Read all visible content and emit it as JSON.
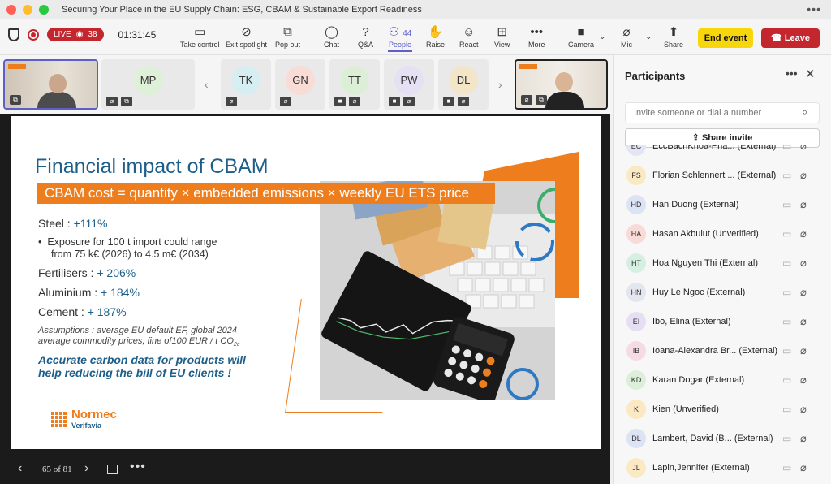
{
  "window": {
    "title": "Securing Your Place in the EU Supply Chain: ESG, CBAM & Sustainable Export Readiness"
  },
  "toolbar": {
    "live_label": "LIVE",
    "viewer_count": "38",
    "timer": "01:31:45",
    "people_count": "44",
    "buttons": [
      {
        "label": "Take control",
        "icon": "take-control-icon"
      },
      {
        "label": "Exit spotlight",
        "icon": "spotlight-off-icon"
      },
      {
        "label": "Pop out",
        "icon": "pop-out-icon"
      },
      {
        "label": "Chat",
        "icon": "chat-icon"
      },
      {
        "label": "Q&A",
        "icon": "qna-icon"
      },
      {
        "label": "People",
        "icon": "people-icon"
      },
      {
        "label": "Raise",
        "icon": "raise-hand-icon"
      },
      {
        "label": "React",
        "icon": "react-icon"
      },
      {
        "label": "View",
        "icon": "view-icon"
      },
      {
        "label": "More",
        "icon": "more-icon"
      },
      {
        "label": "Camera",
        "icon": "camera-icon"
      },
      {
        "label": "Mic",
        "icon": "mic-off-icon"
      },
      {
        "label": "Share",
        "icon": "share-icon"
      }
    ],
    "end_event": "End event",
    "leave": "Leave"
  },
  "gallery": {
    "tiles": [
      {
        "initials": "MP",
        "color": "#dff0d8"
      },
      {
        "initials": "TK",
        "color": "#d6eef2"
      },
      {
        "initials": "GN",
        "color": "#f8dcd5"
      },
      {
        "initials": "TT",
        "color": "#dcefd6"
      },
      {
        "initials": "PW",
        "color": "#e6e0f4"
      },
      {
        "initials": "DL",
        "color": "#f3e6c8"
      }
    ]
  },
  "slide": {
    "title": "Financial impact of CBAM",
    "formula": "CBAM cost = quantity × embedded emissions × weekly EU ETS price",
    "steel_label": "Steel : ",
    "steel_value": "+111%",
    "bullet_line1": "Exposure for 100 t import could range",
    "bullet_line2": "from 75 k€ (2026) to 4.5 m€ (2034)",
    "fert_label": "Fertilisers : ",
    "fert_value": "+ 206%",
    "alu_label": "Aluminium : ",
    "alu_value": "+ 184%",
    "cement_label": "Cement : ",
    "cement_value": "+ 187%",
    "assumption_line1": "Assumptions : average EU default EF, global 2024",
    "assumption_line2": "average commodity prices, fine of100 EUR / t CO",
    "assumption_sub": "2e",
    "accurate_line1": "Accurate carbon data for products will",
    "accurate_line2": "help reducing the bill of EU clients !",
    "logo_name": "Normec",
    "logo_sub": "Verifavia",
    "colors": {
      "accent": "#ee7d1d",
      "title": "#1e5f8a"
    }
  },
  "stage": {
    "page_indicator": "65 of 81"
  },
  "participants": {
    "title": "Participants",
    "invite_placeholder": "Invite someone or dial a number",
    "share_invite": "Share invite",
    "list": [
      {
        "initials": "EC",
        "name": "EccBachKhoa-Pha... (External)",
        "color": "#e3e5f3"
      },
      {
        "initials": "FS",
        "name": "Florian Schlennert ... (External)",
        "color": "#fbe9c4"
      },
      {
        "initials": "HD",
        "name": "Han Duong (External)",
        "color": "#dbe3f5"
      },
      {
        "initials": "HA",
        "name": "Hasan Akbulut (Unverified)",
        "color": "#f8dad6"
      },
      {
        "initials": "HT",
        "name": "Hoa Nguyen Thi (External)",
        "color": "#d6efe3"
      },
      {
        "initials": "HN",
        "name": "Huy Le Ngoc (External)",
        "color": "#e3e5ef"
      },
      {
        "initials": "EI",
        "name": "Ibo, Elina (External)",
        "color": "#e6dff4"
      },
      {
        "initials": "IB",
        "name": "Ioana-Alexandra Br... (External)",
        "color": "#f6dbe3"
      },
      {
        "initials": "KD",
        "name": "Karan Dogar (External)",
        "color": "#dcefd8"
      },
      {
        "initials": "K",
        "name": "Kien (Unverified)",
        "color": "#fbe9c4"
      },
      {
        "initials": "DL",
        "name": "Lambert, David (B... (External)",
        "color": "#dbe3f5"
      },
      {
        "initials": "JL",
        "name": "Lapin,Jennifer (External)",
        "color": "#fbe9c4"
      }
    ]
  }
}
